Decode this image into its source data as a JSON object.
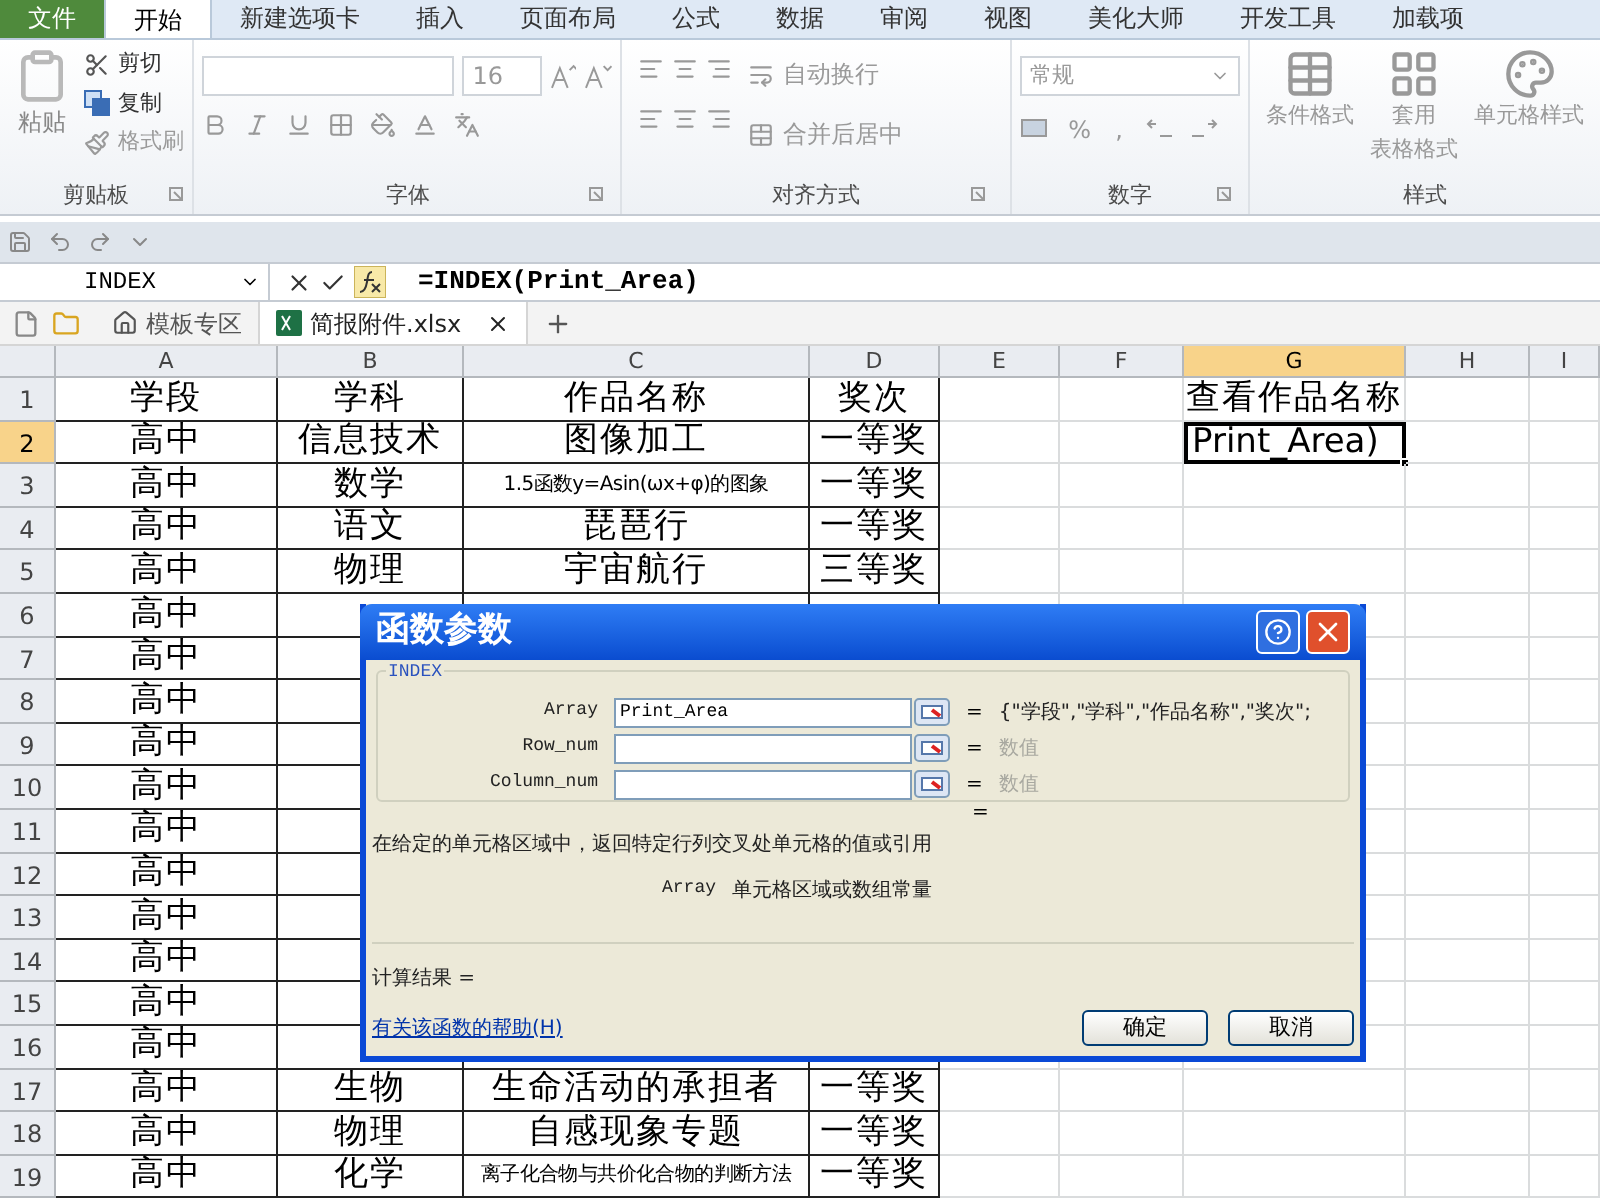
{
  "ribbon_tabs": [
    {
      "label": "文件",
      "kind": "file",
      "selected": false
    },
    {
      "label": "开始",
      "kind": "tab",
      "selected": true
    },
    {
      "label": "新建选项卡",
      "kind": "tab",
      "selected": false
    },
    {
      "label": "插入",
      "kind": "tab",
      "selected": false
    },
    {
      "label": "页面布局",
      "kind": "tab",
      "selected": false
    },
    {
      "label": "公式",
      "kind": "tab",
      "selected": false
    },
    {
      "label": "数据",
      "kind": "tab",
      "selected": false
    },
    {
      "label": "审阅",
      "kind": "tab",
      "selected": false
    },
    {
      "label": "视图",
      "kind": "tab",
      "selected": false
    },
    {
      "label": "美化大师",
      "kind": "tab",
      "selected": false
    },
    {
      "label": "开发工具",
      "kind": "tab",
      "selected": false
    },
    {
      "label": "加载项",
      "kind": "tab",
      "selected": false
    }
  ],
  "clipboard": {
    "paste": "粘贴",
    "cut": "剪切",
    "copy": "复制",
    "format_painter": "格式刷",
    "label": "剪贴板"
  },
  "font": {
    "size": "16",
    "label": "字体"
  },
  "alignment": {
    "wrap": "自动换行",
    "merge": "合并后居中",
    "label": "对齐方式"
  },
  "number": {
    "format": "常规",
    "percent": "%",
    "comma": ",",
    "label": "数字"
  },
  "styles": {
    "conditional": "条件格式",
    "table_line1": "套用",
    "table_line2": "表格格式",
    "cell_styles": "单元格样式",
    "label": "样式"
  },
  "name_box": "INDEX",
  "formula": "=INDEX(Print_Area)",
  "file_tabs": [
    {
      "label": "模板专区",
      "kind": "home",
      "selected": false
    },
    {
      "label": "简报附件.xlsx",
      "kind": "workbook",
      "selected": true
    }
  ],
  "columns": [
    {
      "label": "A",
      "selected": false
    },
    {
      "label": "B",
      "selected": false
    },
    {
      "label": "C",
      "selected": false
    },
    {
      "label": "D",
      "selected": false
    },
    {
      "label": "E",
      "selected": false
    },
    {
      "label": "F",
      "selected": false
    },
    {
      "label": "G",
      "selected": true
    },
    {
      "label": "H",
      "selected": false
    },
    {
      "label": "I",
      "selected": false
    }
  ],
  "rows": [
    {
      "number": "1",
      "selected": false,
      "a": "学段",
      "b": "学科",
      "c": "作品名称",
      "d": "奖次",
      "g": "查看作品名称"
    },
    {
      "number": "2",
      "selected": true,
      "a": "高中",
      "b": "信息技术",
      "c": "图像加工",
      "d": "一等奖",
      "g": {
        "text": "Print_Area)",
        "active": true
      }
    },
    {
      "number": "3",
      "selected": false,
      "a": "高中",
      "b": "数学",
      "c": {
        "text": "1.5函数y=Asin(ωx+φ)的图象",
        "small": true
      },
      "d": "一等奖"
    },
    {
      "number": "4",
      "selected": false,
      "a": "高中",
      "b": "语文",
      "c": "琵琶行",
      "d": "一等奖"
    },
    {
      "number": "5",
      "selected": false,
      "a": "高中",
      "b": "物理",
      "c": "宇宙航行",
      "d": "三等奖"
    },
    {
      "number": "6",
      "selected": false,
      "a": "高中"
    },
    {
      "number": "7",
      "selected": false,
      "a": "高中"
    },
    {
      "number": "8",
      "selected": false,
      "a": "高中"
    },
    {
      "number": "9",
      "selected": false,
      "a": "高中"
    },
    {
      "number": "10",
      "selected": false,
      "a": "高中"
    },
    {
      "number": "11",
      "selected": false,
      "a": "高中"
    },
    {
      "number": "12",
      "selected": false,
      "a": "高中"
    },
    {
      "number": "13",
      "selected": false,
      "a": "高中"
    },
    {
      "number": "14",
      "selected": false,
      "a": "高中"
    },
    {
      "number": "15",
      "selected": false,
      "a": "高中"
    },
    {
      "number": "16",
      "selected": false,
      "a": "高中"
    },
    {
      "number": "17",
      "selected": false,
      "a": "高中",
      "b": "生物",
      "c": "生命活动的承担者",
      "d": "一等奖"
    },
    {
      "number": "18",
      "selected": false,
      "a": "高中",
      "b": "物理",
      "c": "自感现象专题",
      "d": "一等奖"
    },
    {
      "number": "19",
      "selected": false,
      "a": "高中",
      "b": "化学",
      "c": {
        "text": "离子化合物与共价化合物的判断方法",
        "small": true
      },
      "d": "一等奖"
    }
  ],
  "dialog": {
    "title": "函数参数",
    "function_name": "INDEX",
    "arguments": [
      {
        "name": "Array",
        "value": "Print_Area",
        "equals": "=",
        "result": "{\"学段\",\"学科\",\"作品名称\",\"奖次\";",
        "dimmed": false
      },
      {
        "name": "Row_num",
        "equals": "=",
        "result": "数值",
        "dimmed": true
      },
      {
        "name": "Column_num",
        "equals": "=",
        "result": "数值",
        "dimmed": true
      }
    ],
    "formula_equals": "=",
    "description": "在给定的单元格区域中，返回特定行列交叉处单元格的值或引用",
    "arg_help_name": "Array",
    "arg_help": "单元格区域或数组常量",
    "result_label": "计算结果 =",
    "help_link": "有关该函数的帮助(H)",
    "buttons": [
      "确定",
      "取消"
    ]
  }
}
